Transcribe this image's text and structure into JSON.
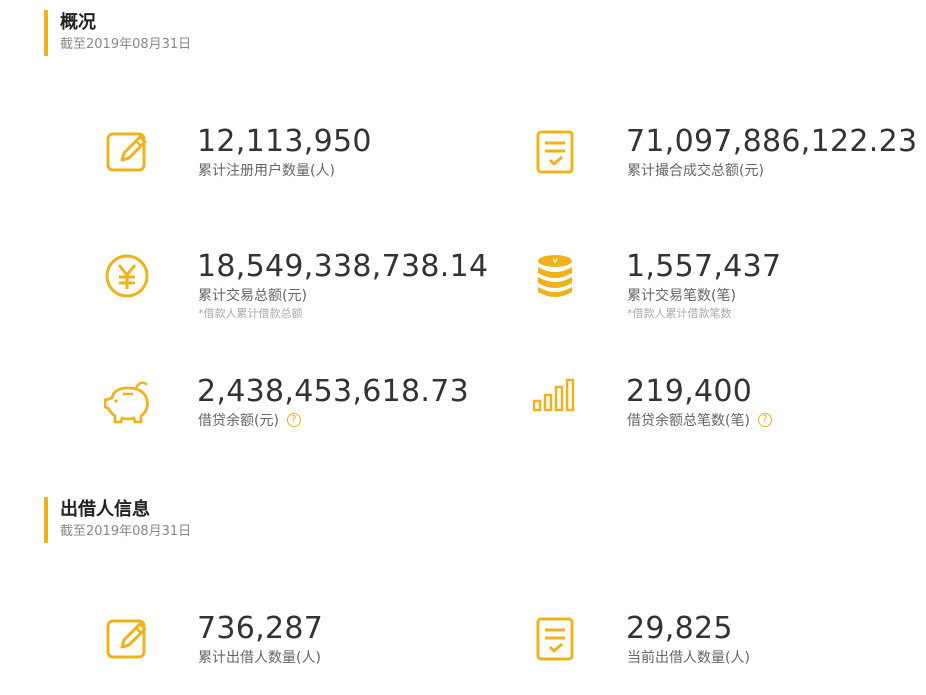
{
  "colors": {
    "accent": "#f0b21b",
    "value_text": "#333333",
    "label_text": "#666666",
    "note_text": "#aaaaaa"
  },
  "overview": {
    "title": "概况",
    "subtitle": "截至2019年08月31日",
    "stats": [
      {
        "icon": "edit-icon",
        "value": "12,113,950",
        "label": "累计注册用户数量(人)"
      },
      {
        "icon": "checklist-icon",
        "value": "71,097,886,122.23",
        "label": "累计撮合成交总额(元)"
      },
      {
        "icon": "yuan-coin-icon",
        "value": "18,549,338,738.14",
        "label": "累计交易总额(元)",
        "note": "*借款人累计借款总额"
      },
      {
        "icon": "coin-stack-icon",
        "value": "1,557,437",
        "label": "累计交易笔数(笔)",
        "note": "*借款人累计借款笔数"
      },
      {
        "icon": "piggy-bank-icon",
        "value": "2,438,453,618.73",
        "label": "借贷余额(元)",
        "help": "?"
      },
      {
        "icon": "bar-chart-icon",
        "value": "219,400",
        "label": "借贷余额总笔数(笔)",
        "help": "?"
      }
    ]
  },
  "lender": {
    "title": "出借人信息",
    "subtitle": "截至2019年08月31日",
    "stats": [
      {
        "icon": "edit-icon",
        "value": "736,287",
        "label": "累计出借人数量(人)"
      },
      {
        "icon": "checklist-icon",
        "value": "29,825",
        "label": "当前出借人数量(人)"
      }
    ]
  }
}
